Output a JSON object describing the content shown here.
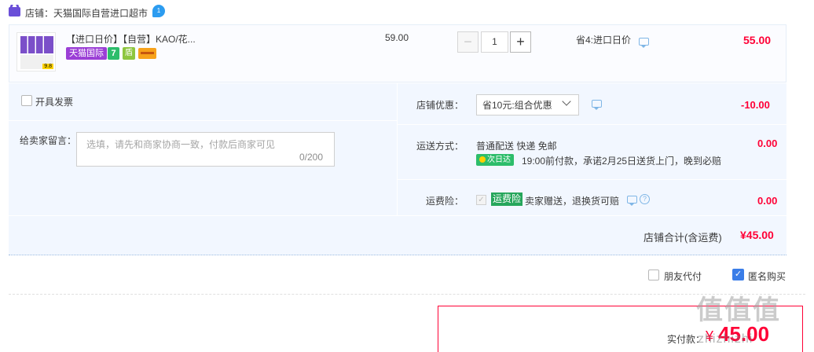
{
  "shop": {
    "label": "店铺：天猫国际自营进口超市",
    "wangwang_badge": "1"
  },
  "item": {
    "title": "【进口日价】【自营】KAO/花...",
    "thumb_tag": "9.8",
    "badges": {
      "tmall": "天猫国际",
      "seven": "7",
      "shield": "盾"
    },
    "unit_price": "59.00",
    "quantity": "1",
    "minus_label": "−",
    "plus_label": "+",
    "promo": "省4:进口日价",
    "subtotal": "55.00"
  },
  "invoice": {
    "label": "开具发票"
  },
  "message": {
    "label": "给卖家留言：",
    "placeholder": "选填，请先和商家协商一致，付款后商家可见",
    "count": "0/200"
  },
  "discount": {
    "label": "店铺优惠：",
    "selected": "省10元:组合优惠",
    "amount": "-10.00"
  },
  "shipping": {
    "label": "运送方式：",
    "method": "普通配送 快递 免邮",
    "badge": "次日达",
    "promise": "19:00前付款，承诺2月25日送货上门，晚到必赔",
    "amount": "0.00"
  },
  "insurance": {
    "label": "运费险：",
    "badge": "运费险",
    "desc": "卖家赠送，退换货可赔",
    "amount": "0.00",
    "help": "?"
  },
  "shop_total": {
    "label": "店铺合计(含运费)",
    "amount": "¥45.00"
  },
  "options": {
    "friend_pay": "朋友代付",
    "anonymous": "匿名购买",
    "anonymous_checked": "✓"
  },
  "payment": {
    "label": "实付款：",
    "currency": "¥",
    "amount": "45.00"
  },
  "watermark": {
    "main": "值值值",
    "sub": "zhizhizhi"
  },
  "colors": {
    "accent": "#ff0036",
    "panel": "#f2f7ff",
    "tmall_purple": "#9b3fd6",
    "green": "#2dbd6b"
  },
  "icons": [
    "shop-icon",
    "wangwang-icon",
    "chat-icon",
    "chevron-down-icon",
    "bolt-icon",
    "help-icon",
    "check-icon"
  ]
}
